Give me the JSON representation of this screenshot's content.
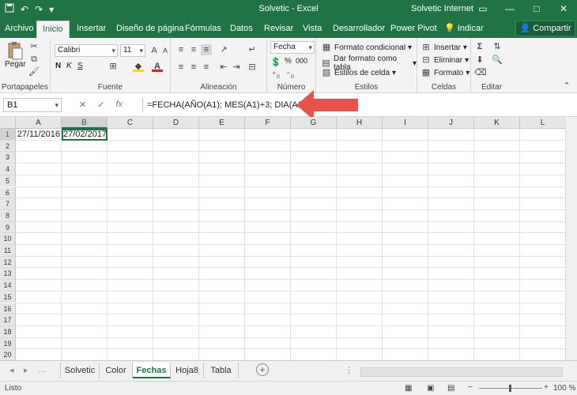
{
  "titlebar": {
    "title": "Solvetic - Excel",
    "user": "Solvetic Internet",
    "quick_access": [
      "save-icon",
      "undo-icon",
      "redo-icon",
      "customize-icon"
    ]
  },
  "menu": {
    "tabs": [
      {
        "label": "Archivo"
      },
      {
        "label": "Inicio"
      },
      {
        "label": "Insertar"
      },
      {
        "label": "Diseño de página"
      },
      {
        "label": "Fórmulas"
      },
      {
        "label": "Datos"
      },
      {
        "label": "Revisar"
      },
      {
        "label": "Vista"
      },
      {
        "label": "Desarrollador"
      },
      {
        "label": "Power Pivot"
      },
      {
        "label": "Indicar"
      }
    ],
    "active_tab": "Inicio",
    "share_label": "Compartir"
  },
  "ribbon": {
    "clipboard": {
      "label": "Portapapeles",
      "paste_label": "Pegar"
    },
    "font": {
      "label": "Fuente",
      "font_name": "Calibri",
      "font_size": "11",
      "bold": "N",
      "italic": "K",
      "underline": "S"
    },
    "alignment": {
      "label": "Alineación"
    },
    "number": {
      "label": "Número",
      "format": "Fecha",
      "percent": "%",
      "thousands": "000"
    },
    "styles": {
      "label": "Estilos",
      "conditional": "Formato condicional",
      "as_table": "Dar formato como tabla",
      "cell_styles": "Estilos de celda"
    },
    "cells": {
      "label": "Celdas",
      "insert": "Insertar",
      "delete": "Eliminar",
      "format": "Formato"
    },
    "editing": {
      "label": "Editar"
    }
  },
  "formula_bar": {
    "name_box": "B1",
    "formula": "=FECHA(AÑO(A1); MES(A1)+3; DIA(A1))"
  },
  "grid": {
    "columns": [
      "A",
      "B",
      "C",
      "D",
      "E",
      "F",
      "G",
      "H",
      "I",
      "J",
      "K",
      "L"
    ],
    "rows": [
      "1",
      "2",
      "3",
      "4",
      "5",
      "6",
      "7",
      "8",
      "9",
      "10",
      "11",
      "12",
      "13",
      "14",
      "15",
      "16",
      "17",
      "18",
      "19",
      "20"
    ],
    "cells": {
      "A1": "27/11/2016",
      "B1": "27/02/2017"
    },
    "active_cell": "B1"
  },
  "sheets": {
    "tabs": [
      {
        "label": "Solvetic"
      },
      {
        "label": "Color"
      },
      {
        "label": "Fechas"
      },
      {
        "label": "Hoja8"
      },
      {
        "label": "Tabla"
      }
    ],
    "active": "Fechas"
  },
  "status": {
    "mode": "Listo",
    "zoom": "100 %"
  },
  "colors": {
    "accent": "#217346",
    "arrow": "#e8524a"
  }
}
